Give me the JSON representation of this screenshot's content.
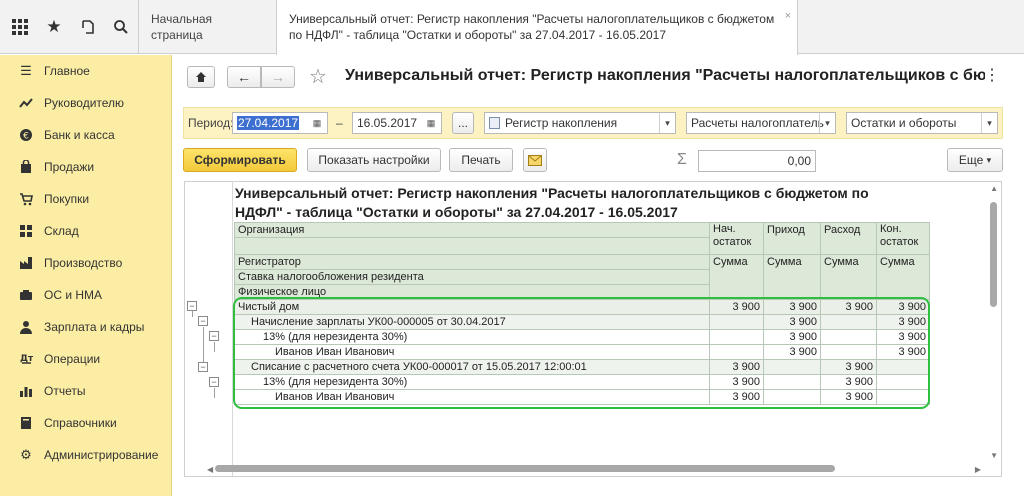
{
  "topbar": {
    "icons": [
      "apps-grid-icon",
      "star-icon",
      "history-icon",
      "search-icon"
    ],
    "tabs": [
      {
        "label": "Начальная страница"
      },
      {
        "label": "Универсальный отчет: Регистр накопления \"Расчеты налогоплательщиков с бюджетом по НДФЛ\" - таблица \"Остатки и обороты\" за 27.04.2017 - 16.05.2017",
        "close": "×"
      }
    ]
  },
  "sidebar": {
    "items": [
      {
        "label": "Главное",
        "icon": "menu-icon"
      },
      {
        "label": "Руководителю",
        "icon": "trend-icon"
      },
      {
        "label": "Банк и касса",
        "icon": "coin-icon"
      },
      {
        "label": "Продажи",
        "icon": "cart-icon"
      },
      {
        "label": "Покупки",
        "icon": "basket-icon"
      },
      {
        "label": "Склад",
        "icon": "warehouse-icon"
      },
      {
        "label": "Производство",
        "icon": "factory-icon"
      },
      {
        "label": "ОС и НМА",
        "icon": "assets-icon"
      },
      {
        "label": "Зарплата и кадры",
        "icon": "person-icon"
      },
      {
        "label": "Операции",
        "icon": "operations-icon"
      },
      {
        "label": "Отчеты",
        "icon": "chart-icon"
      },
      {
        "label": "Справочники",
        "icon": "book-icon"
      },
      {
        "label": "Администрирование",
        "icon": "gear-icon"
      }
    ]
  },
  "header": {
    "title": "Универсальный отчет: Регистр накопления \"Расчеты налогоплательщиков с бю",
    "more": "⋮"
  },
  "filters": {
    "period_label": "Период:",
    "date_from": "27.04.2017",
    "dash": "–",
    "date_to": "16.05.2017",
    "ellipsis": "...",
    "type": "Регистр накопления",
    "register": "Расчеты налогоплатель",
    "table": "Остатки и обороты"
  },
  "toolbar": {
    "generate": "Сформировать",
    "settings": "Показать настройки",
    "print": "Печать",
    "sigma": "Σ",
    "sum_value": "0,00",
    "more": "Еще"
  },
  "report": {
    "title_line1": "Универсальный отчет: Регистр накопления \"Расчеты налогоплательщиков с бюджетом по",
    "title_line2": "НДФЛ\" - таблица \"Остатки и обороты\" за 27.04.2017 - 16.05.2017",
    "headers": {
      "org": "Организация",
      "registrar": "Регистратор",
      "rate": "Ставка налогообложения резидента",
      "person": "Физическое лицо",
      "start": "Нач. остаток",
      "income": "Приход",
      "expense": "Расход",
      "end": "Кон. остаток",
      "sum": "Сумма"
    },
    "rows": [
      {
        "name": "Чистый дом",
        "start": "3 900",
        "income": "3 900",
        "expense": "3 900",
        "end": "3 900"
      },
      {
        "name": "Начисление зарплаты УК00-000005 от 30.04.2017",
        "start": "",
        "income": "3 900",
        "expense": "",
        "end": "3 900"
      },
      {
        "name": "13% (для нерезидента 30%)",
        "start": "",
        "income": "3 900",
        "expense": "",
        "end": "3 900"
      },
      {
        "name": "Иванов Иван Иванович",
        "start": "",
        "income": "3 900",
        "expense": "",
        "end": "3 900"
      },
      {
        "name": "Списание с расчетного счета УК00-000017 от 15.05.2017 12:00:01",
        "start": "3 900",
        "income": "",
        "expense": "3 900",
        "end": ""
      },
      {
        "name": "13% (для нерезидента 30%)",
        "start": "3 900",
        "income": "",
        "expense": "3 900",
        "end": ""
      },
      {
        "name": "Иванов Иван Иванович",
        "start": "3 900",
        "income": "",
        "expense": "3 900",
        "end": ""
      }
    ]
  }
}
